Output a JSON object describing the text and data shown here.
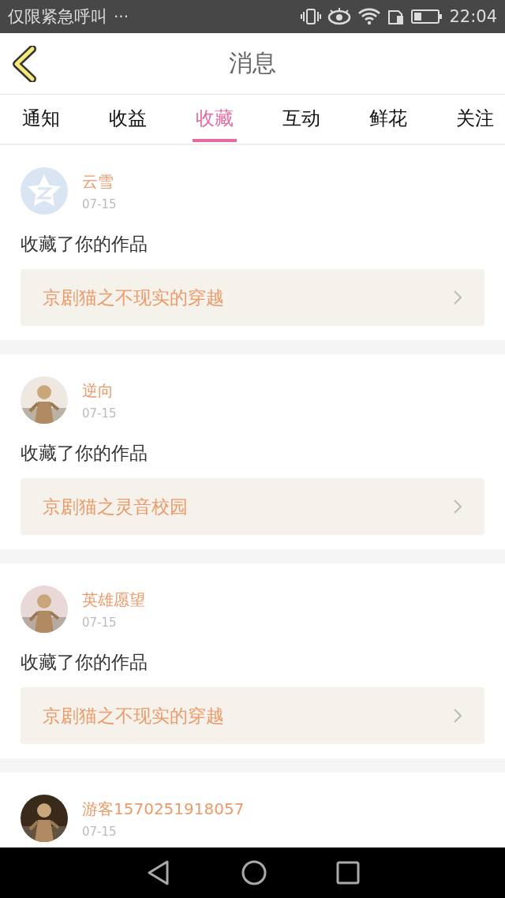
{
  "status_bar": {
    "carrier": "仅限紧急呼叫",
    "more": "···",
    "time": "22:04"
  },
  "header": {
    "title": "消息"
  },
  "tabs": [
    {
      "label": "通知",
      "selected": false
    },
    {
      "label": "收益",
      "selected": false
    },
    {
      "label": "收藏",
      "selected": true
    },
    {
      "label": "互动",
      "selected": false
    },
    {
      "label": "鲜花",
      "selected": false
    },
    {
      "label": "关注",
      "selected": false
    }
  ],
  "messages": [
    {
      "avatar": {
        "kind": "default"
      },
      "name": "云雪",
      "date": "07-15",
      "action": "收藏了你的作品",
      "work": "京剧猫之不现实的穿越"
    },
    {
      "name": "逆向",
      "date": "07-15",
      "action": "收藏了你的作品",
      "work": "京剧猫之灵音校园"
    },
    {
      "name": "英雄愿望",
      "date": "07-15",
      "action": "收藏了你的作品",
      "work": "京剧猫之不现实的穿越"
    },
    {
      "name": "游客1570251918057",
      "date": "07-15"
    }
  ]
}
